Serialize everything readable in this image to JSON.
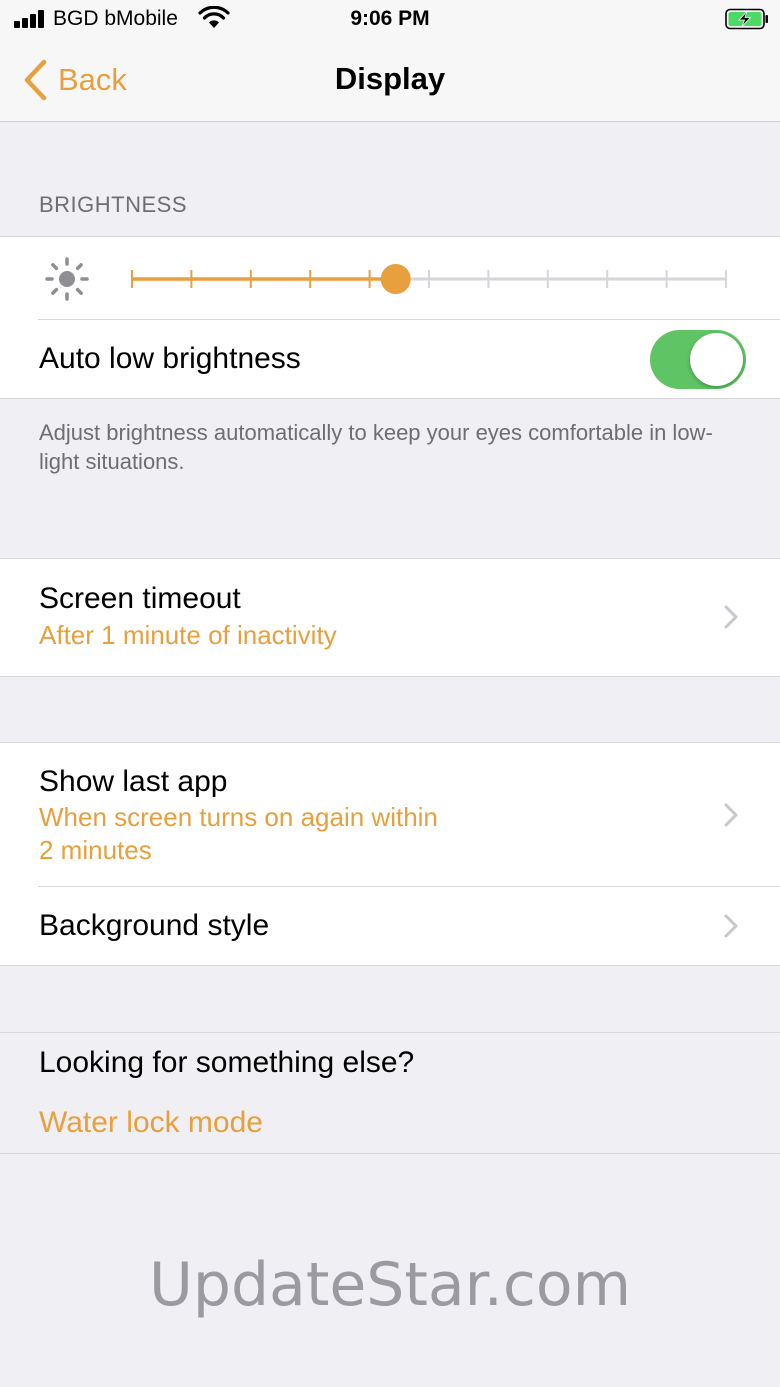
{
  "status_bar": {
    "carrier": "BGD bMobile",
    "time": "9:06 PM",
    "signal_icon": "signal-bars-icon",
    "wifi_icon": "wifi-icon",
    "battery_icon": "battery-charging-icon"
  },
  "nav": {
    "back_label": "Back",
    "title": "Display"
  },
  "brightness": {
    "header": "BRIGHTNESS",
    "icon": "sun-icon",
    "level_fraction": 0.444,
    "steps": 10,
    "auto_low_label": "Auto low brightness",
    "auto_low_enabled": true,
    "footer": "Adjust brightness automatically to keep your eyes comfortable in low-light situations."
  },
  "screen_timeout": {
    "title": "Screen timeout",
    "value": "After 1 minute of inactivity"
  },
  "show_last_app": {
    "title": "Show last app",
    "value_line1": "When screen turns on again within",
    "value_line2": "2 minutes"
  },
  "background_style": {
    "title": "Background style"
  },
  "looking_for": {
    "title": "Looking for something else?",
    "link": "Water lock mode"
  },
  "watermark": "UpdateStar.com",
  "colors": {
    "accent": "#e8a03e",
    "toggle_on": "#5fc463",
    "background": "#efeff4"
  }
}
